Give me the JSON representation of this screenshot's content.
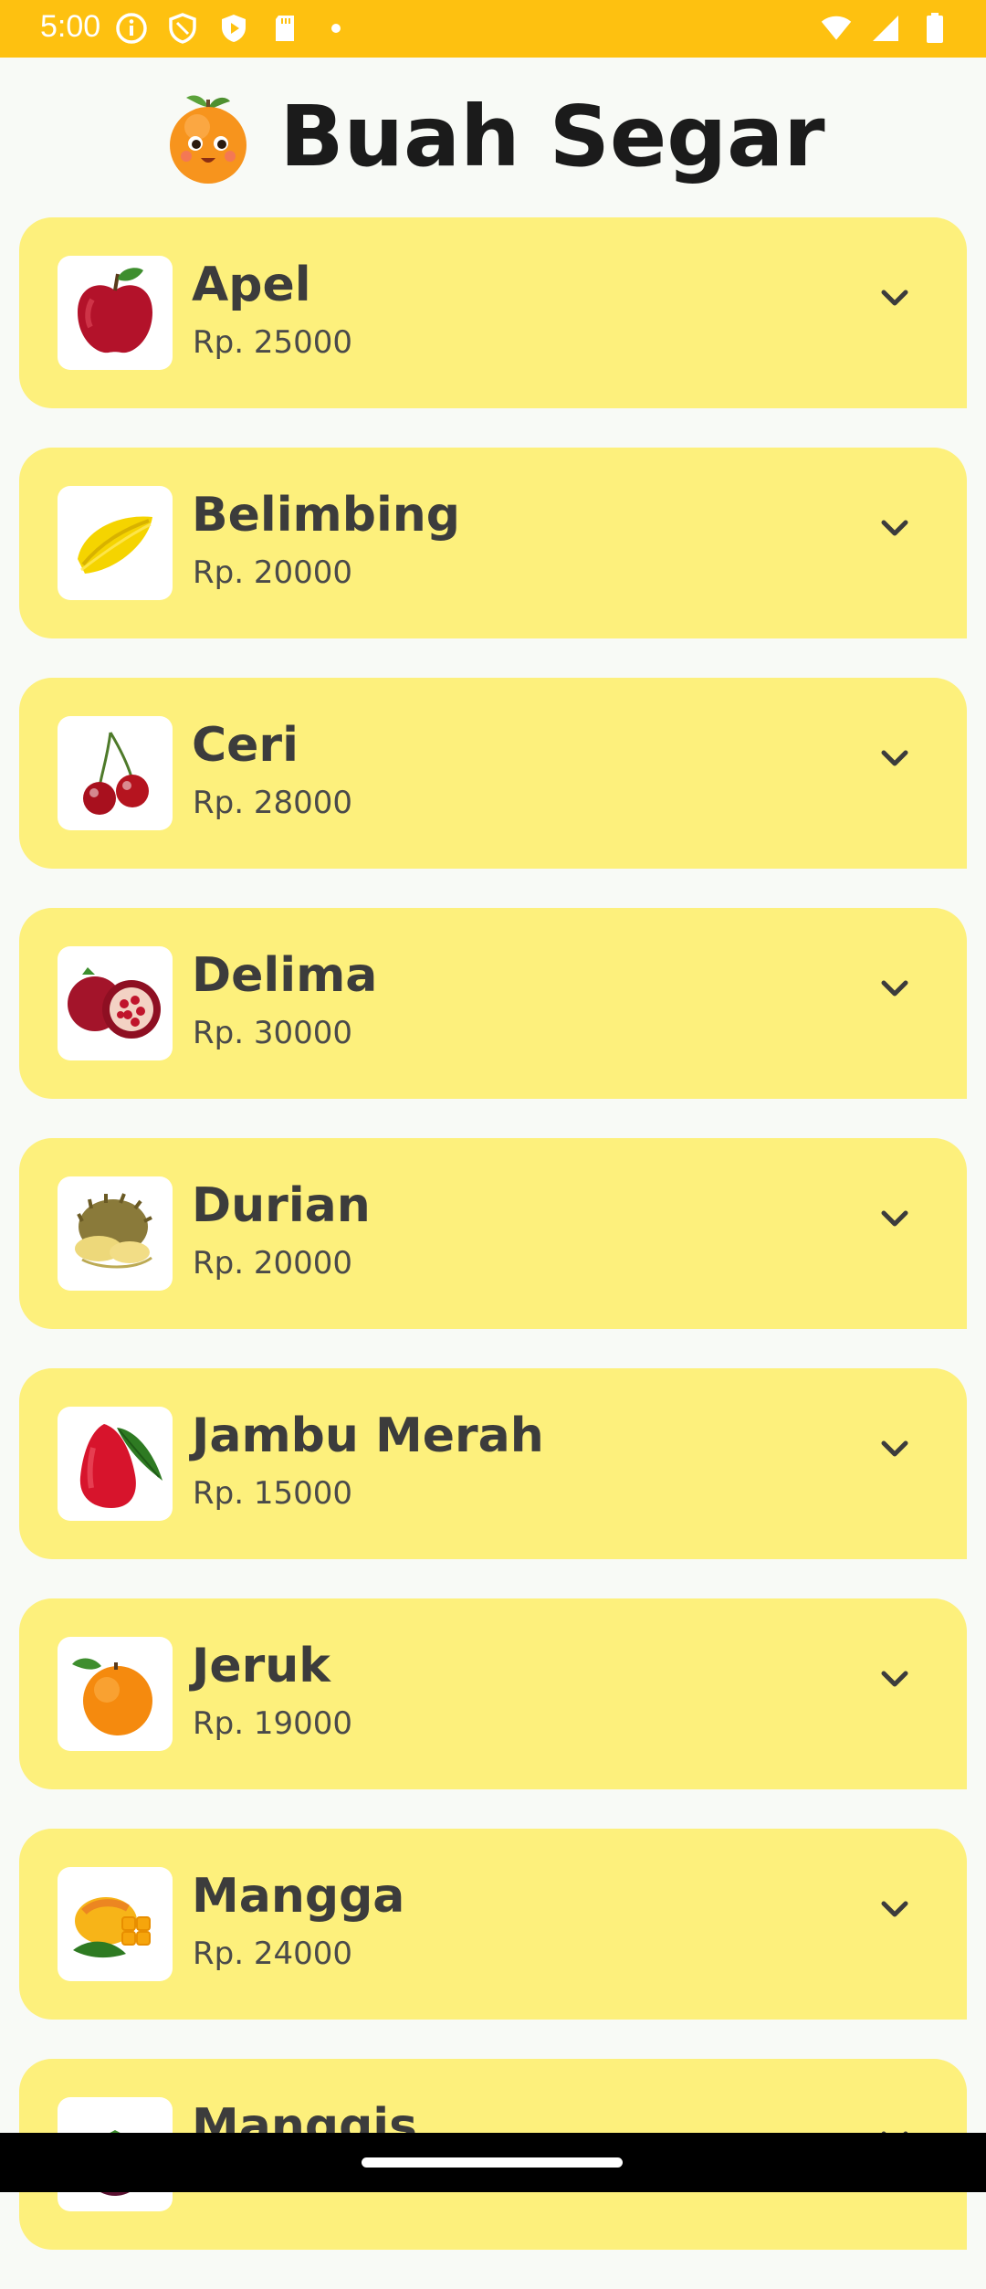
{
  "status_bar": {
    "time": "5:00",
    "left_icons": [
      "info-icon",
      "shield-icon",
      "play-protect-icon",
      "sd-card-icon",
      "dot-icon"
    ],
    "right_icons": [
      "wifi-icon",
      "signal-icon",
      "battery-icon"
    ],
    "background": "#FEC110"
  },
  "header": {
    "title": "Buah Segar",
    "logo_icon": "orange-mascot-icon"
  },
  "colors": {
    "card_background": "#FDF07C",
    "page_background": "#F8FAF6",
    "text": "#3C3C3C"
  },
  "fruits": [
    {
      "name": "Apel",
      "price": "Rp. 25000",
      "icon": "apple-icon"
    },
    {
      "name": "Belimbing",
      "price": "Rp. 20000",
      "icon": "starfruit-icon"
    },
    {
      "name": "Ceri",
      "price": "Rp. 28000",
      "icon": "cherry-icon"
    },
    {
      "name": "Delima",
      "price": "Rp. 30000",
      "icon": "pomegranate-icon"
    },
    {
      "name": "Durian",
      "price": "Rp. 20000",
      "icon": "durian-icon"
    },
    {
      "name": "Jambu Merah",
      "price": "Rp. 15000",
      "icon": "rose-apple-icon"
    },
    {
      "name": "Jeruk",
      "price": "Rp. 19000",
      "icon": "orange-icon"
    },
    {
      "name": "Mangga",
      "price": "Rp. 24000",
      "icon": "mango-icon"
    },
    {
      "name": "Manggis",
      "price": "",
      "icon": "mangosteen-icon"
    }
  ]
}
